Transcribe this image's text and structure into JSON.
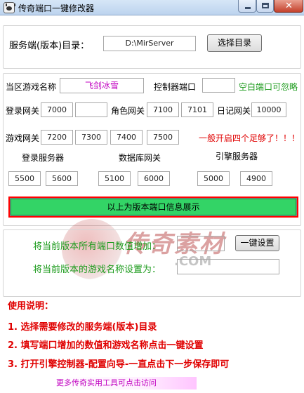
{
  "window": {
    "title": "传奇端口一键修改器",
    "icon": "app-panda-icon"
  },
  "server_dir": {
    "label": "服务端(版本)目录：",
    "value": "D:\\MirServer",
    "browse_button": "选择目录"
  },
  "zone": {
    "name_label": "当区游戏名称",
    "name_value": "飞剑冰雪",
    "controller_port_label": "控制器端口",
    "controller_port_value": "",
    "controller_hint": "空白端口可忽略"
  },
  "gates": {
    "login_label": "登录网关",
    "login_ports": [
      "7000",
      ""
    ],
    "role_label": "角色网关",
    "role_ports": [
      "7100",
      "7101"
    ],
    "log_label": "日记网关",
    "log_port": "10000",
    "game_label": "游戏网关",
    "game_ports": [
      "7200",
      "7300",
      "7400",
      "7500"
    ],
    "game_hint": "一般开启四个足够了！！！"
  },
  "servers": {
    "login_label": "登录服务器",
    "login_ports": [
      "5500",
      "5600"
    ],
    "db_label": "数据库网关",
    "db_ports": [
      "5100",
      "6000"
    ],
    "engine_label": "引擎服务器",
    "engine_ports": [
      "5000",
      "4900"
    ]
  },
  "banner": {
    "text": "以上为版本端口信息展示"
  },
  "increment": {
    "label": "将当前版本所有端口数值增加：",
    "value": "",
    "apply_button": "一键设置"
  },
  "rename": {
    "label": "将当前版本的游戏名称设置为：",
    "value": ""
  },
  "watermark": {
    "chars": "传奇素材",
    "sub": ".COM"
  },
  "instructions": {
    "title": "使用说明：",
    "steps": [
      "1. 选择需要修改的服务端(版本)目录",
      "2. 填写端口增加的数值和游戏名称点击一键设置",
      "3. 打开引擎控制器-配置向导-一直点击下一步保存即可"
    ]
  },
  "footer": {
    "link_text": "更多传奇实用工具可点击访问"
  },
  "colors": {
    "accent_green": "#1a9a1a",
    "warning_red": "#e00000",
    "name_purple": "#c000c0",
    "banner_green": "#33d466"
  }
}
